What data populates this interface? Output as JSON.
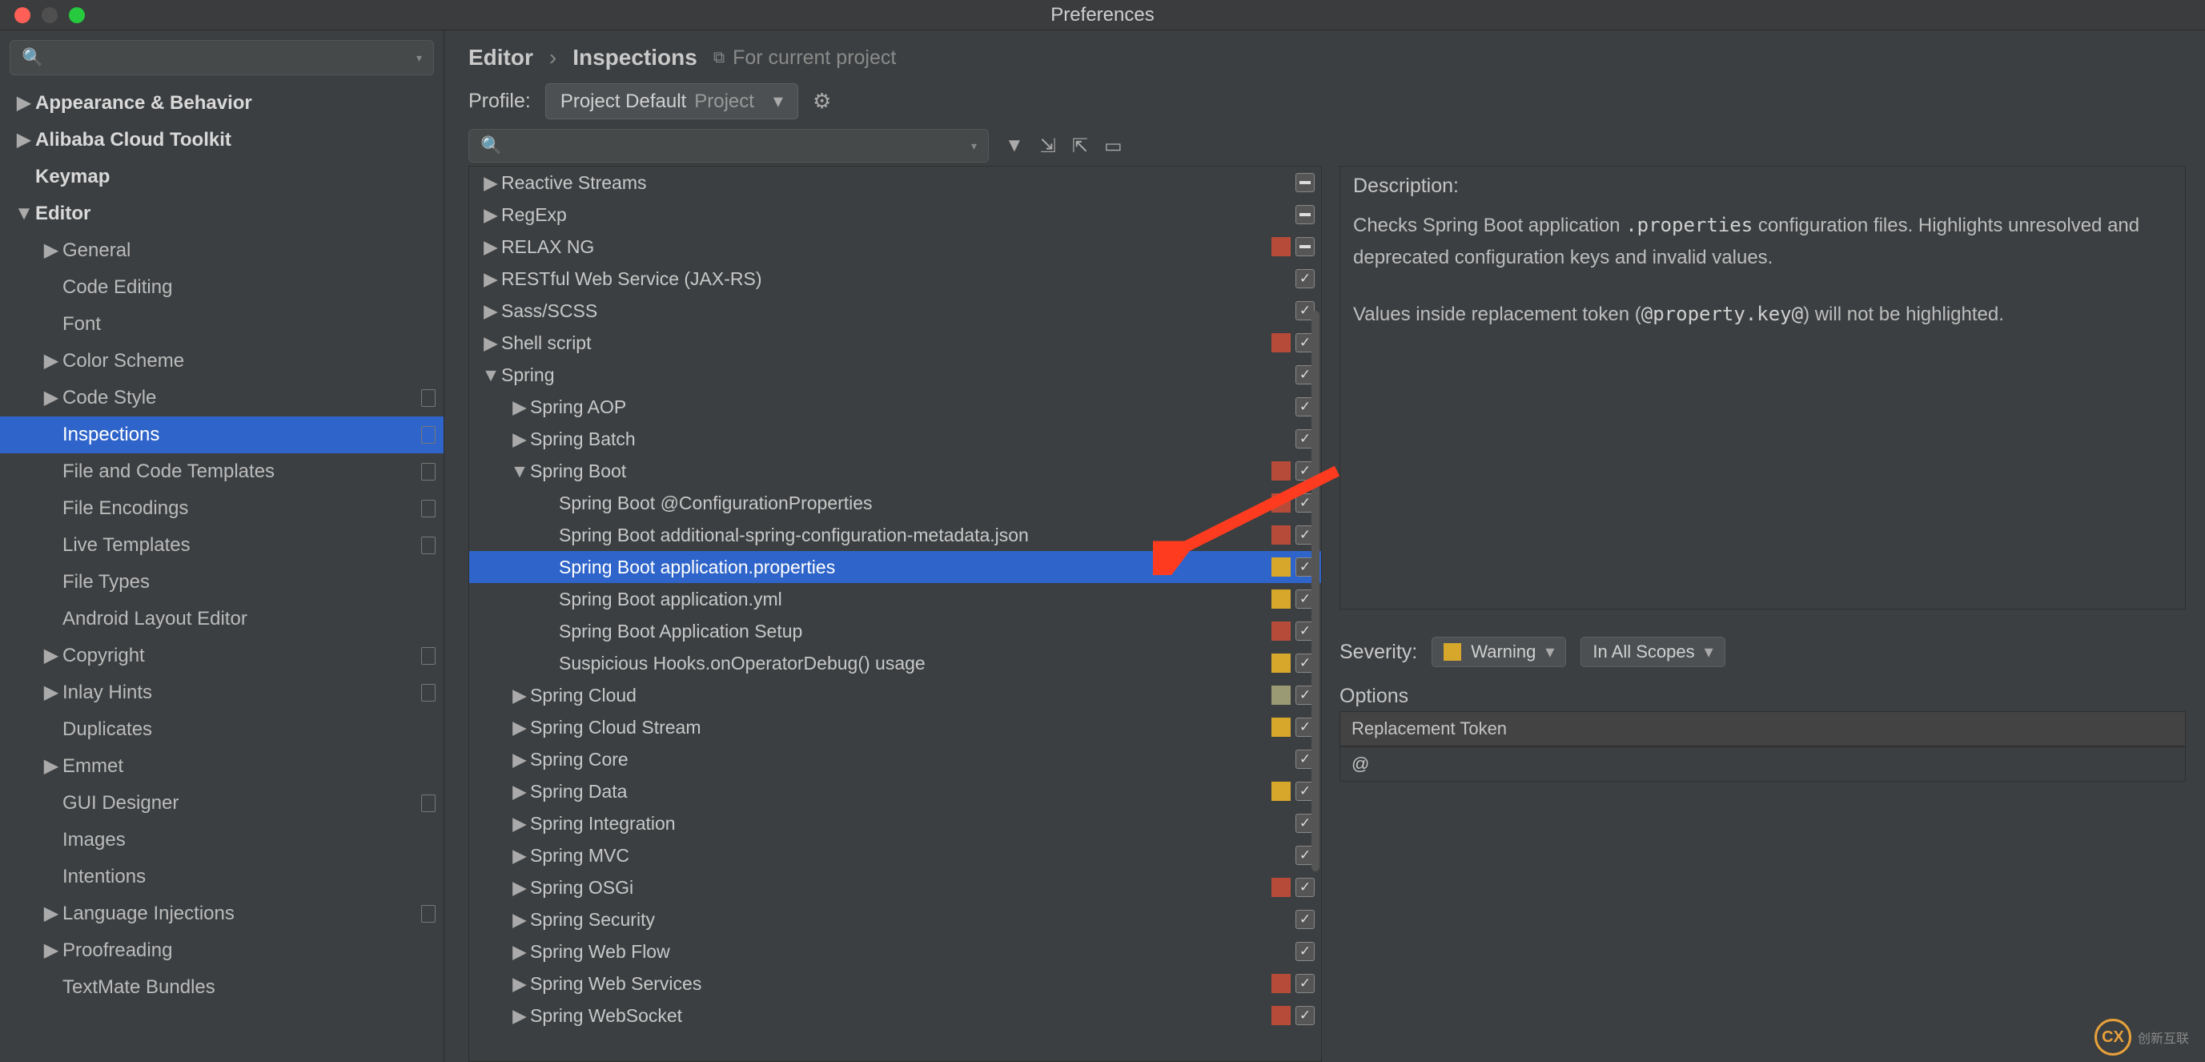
{
  "window": {
    "title": "Preferences"
  },
  "sidebar": {
    "search_placeholder": "",
    "items": [
      {
        "label": "Appearance & Behavior",
        "arrow": "▶",
        "bold": true,
        "indent": 0
      },
      {
        "label": "Alibaba Cloud Toolkit",
        "arrow": "▶",
        "bold": true,
        "indent": 0
      },
      {
        "label": "Keymap",
        "arrow": "",
        "bold": true,
        "indent": 0
      },
      {
        "label": "Editor",
        "arrow": "▼",
        "bold": true,
        "indent": 0
      },
      {
        "label": "General",
        "arrow": "▶",
        "bold": false,
        "indent": 1
      },
      {
        "label": "Code Editing",
        "arrow": "",
        "bold": false,
        "indent": 1
      },
      {
        "label": "Font",
        "arrow": "",
        "bold": false,
        "indent": 1
      },
      {
        "label": "Color Scheme",
        "arrow": "▶",
        "bold": false,
        "indent": 1
      },
      {
        "label": "Code Style",
        "arrow": "▶",
        "bold": false,
        "indent": 1,
        "chip": true
      },
      {
        "label": "Inspections",
        "arrow": "",
        "bold": false,
        "indent": 1,
        "selected": true,
        "chip": true
      },
      {
        "label": "File and Code Templates",
        "arrow": "",
        "bold": false,
        "indent": 1,
        "chip": true
      },
      {
        "label": "File Encodings",
        "arrow": "",
        "bold": false,
        "indent": 1,
        "chip": true
      },
      {
        "label": "Live Templates",
        "arrow": "",
        "bold": false,
        "indent": 1,
        "chip": true
      },
      {
        "label": "File Types",
        "arrow": "",
        "bold": false,
        "indent": 1
      },
      {
        "label": "Android Layout Editor",
        "arrow": "",
        "bold": false,
        "indent": 1
      },
      {
        "label": "Copyright",
        "arrow": "▶",
        "bold": false,
        "indent": 1,
        "chip": true
      },
      {
        "label": "Inlay Hints",
        "arrow": "▶",
        "bold": false,
        "indent": 1,
        "chip": true
      },
      {
        "label": "Duplicates",
        "arrow": "",
        "bold": false,
        "indent": 1
      },
      {
        "label": "Emmet",
        "arrow": "▶",
        "bold": false,
        "indent": 1
      },
      {
        "label": "GUI Designer",
        "arrow": "",
        "bold": false,
        "indent": 1,
        "chip": true
      },
      {
        "label": "Images",
        "arrow": "",
        "bold": false,
        "indent": 1
      },
      {
        "label": "Intentions",
        "arrow": "",
        "bold": false,
        "indent": 1
      },
      {
        "label": "Language Injections",
        "arrow": "▶",
        "bold": false,
        "indent": 1,
        "chip": true
      },
      {
        "label": "Proofreading",
        "arrow": "▶",
        "bold": false,
        "indent": 1
      },
      {
        "label": "TextMate Bundles",
        "arrow": "",
        "bold": false,
        "indent": 1
      }
    ]
  },
  "breadcrumb": {
    "a": "Editor",
    "b": "Inspections",
    "note": "For current project"
  },
  "profile": {
    "label": "Profile:",
    "name": "Project Default",
    "scope": "Project"
  },
  "insp_search_placeholder": "",
  "inspections": [
    {
      "label": "Reactive Streams",
      "arrow": "▶",
      "indent": 0,
      "sev": "",
      "chk": "mixed"
    },
    {
      "label": "RegExp",
      "arrow": "▶",
      "indent": 0,
      "sev": "",
      "chk": "mixed"
    },
    {
      "label": "RELAX NG",
      "arrow": "▶",
      "indent": 0,
      "sev": "red",
      "chk": "mixed"
    },
    {
      "label": "RESTful Web Service (JAX-RS)",
      "arrow": "▶",
      "indent": 0,
      "sev": "",
      "chk": "on"
    },
    {
      "label": "Sass/SCSS",
      "arrow": "▶",
      "indent": 0,
      "sev": "",
      "chk": "on"
    },
    {
      "label": "Shell script",
      "arrow": "▶",
      "indent": 0,
      "sev": "red",
      "chk": "on"
    },
    {
      "label": "Spring",
      "arrow": "▼",
      "indent": 0,
      "sev": "",
      "chk": "on"
    },
    {
      "label": "Spring AOP",
      "arrow": "▶",
      "indent": 1,
      "sev": "",
      "chk": "on"
    },
    {
      "label": "Spring Batch",
      "arrow": "▶",
      "indent": 1,
      "sev": "",
      "chk": "on"
    },
    {
      "label": "Spring Boot",
      "arrow": "▼",
      "indent": 1,
      "sev": "red",
      "chk": "on"
    },
    {
      "label": "Spring Boot @ConfigurationProperties",
      "arrow": "",
      "indent": 2,
      "sev": "red",
      "chk": "on"
    },
    {
      "label": "Spring Boot additional-spring-configuration-metadata.json",
      "arrow": "",
      "indent": 2,
      "sev": "red",
      "chk": "on"
    },
    {
      "label": "Spring Boot application.properties",
      "arrow": "",
      "indent": 2,
      "sev": "yellow",
      "chk": "on",
      "selected": true
    },
    {
      "label": "Spring Boot application.yml",
      "arrow": "",
      "indent": 2,
      "sev": "yellow",
      "chk": "on"
    },
    {
      "label": "Spring Boot Application Setup",
      "arrow": "",
      "indent": 2,
      "sev": "red",
      "chk": "on"
    },
    {
      "label": "Suspicious Hooks.onOperatorDebug() usage",
      "arrow": "",
      "indent": 2,
      "sev": "yellow",
      "chk": "on"
    },
    {
      "label": "Spring Cloud",
      "arrow": "▶",
      "indent": 1,
      "sev": "olive",
      "chk": "on"
    },
    {
      "label": "Spring Cloud Stream",
      "arrow": "▶",
      "indent": 1,
      "sev": "yellow",
      "chk": "on"
    },
    {
      "label": "Spring Core",
      "arrow": "▶",
      "indent": 1,
      "sev": "",
      "chk": "on"
    },
    {
      "label": "Spring Data",
      "arrow": "▶",
      "indent": 1,
      "sev": "yellow",
      "chk": "on"
    },
    {
      "label": "Spring Integration",
      "arrow": "▶",
      "indent": 1,
      "sev": "",
      "chk": "on"
    },
    {
      "label": "Spring MVC",
      "arrow": "▶",
      "indent": 1,
      "sev": "",
      "chk": "on"
    },
    {
      "label": "Spring OSGi",
      "arrow": "▶",
      "indent": 1,
      "sev": "red",
      "chk": "on"
    },
    {
      "label": "Spring Security",
      "arrow": "▶",
      "indent": 1,
      "sev": "",
      "chk": "on"
    },
    {
      "label": "Spring Web Flow",
      "arrow": "▶",
      "indent": 1,
      "sev": "",
      "chk": "on"
    },
    {
      "label": "Spring Web Services",
      "arrow": "▶",
      "indent": 1,
      "sev": "red",
      "chk": "on"
    },
    {
      "label": "Spring WebSocket",
      "arrow": "▶",
      "indent": 1,
      "sev": "red",
      "chk": "on"
    }
  ],
  "description": {
    "heading": "Description:",
    "body_before": "Checks Spring Boot application ",
    "body_code1": ".properties",
    "body_after": " configuration files. Highlights unresolved and deprecated configuration keys and invalid values.",
    "p2_before": "Values inside replacement token (",
    "p2_code": "@property.key@",
    "p2_after": ") will not be highlighted."
  },
  "severity": {
    "label": "Severity:",
    "value": "Warning",
    "scope": "In All Scopes"
  },
  "options": {
    "heading": "Options",
    "opt_label": "Replacement Token",
    "opt_value": "@"
  },
  "watermark": "创新互联"
}
